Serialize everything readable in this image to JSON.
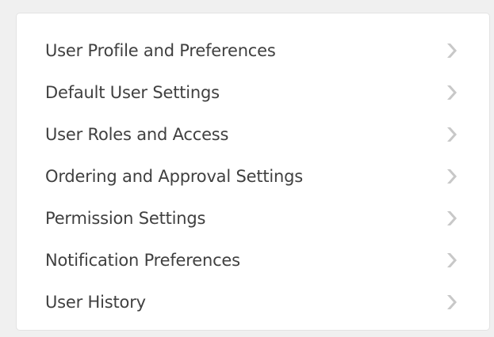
{
  "colors": {
    "page_background": "#f0f0f0",
    "panel_background": "#ffffff",
    "text": "#404040",
    "chevron": "#c8c8c8"
  },
  "menu": {
    "items": [
      {
        "label": "User Profile and Preferences",
        "icon": "chevron-right-icon"
      },
      {
        "label": "Default User Settings",
        "icon": "chevron-right-icon"
      },
      {
        "label": "User Roles and Access",
        "icon": "chevron-right-icon"
      },
      {
        "label": "Ordering and Approval Settings",
        "icon": "chevron-right-icon"
      },
      {
        "label": "Permission Settings",
        "icon": "chevron-right-icon"
      },
      {
        "label": "Notification Preferences",
        "icon": "chevron-right-icon"
      },
      {
        "label": "User History",
        "icon": "chevron-right-icon"
      }
    ]
  }
}
